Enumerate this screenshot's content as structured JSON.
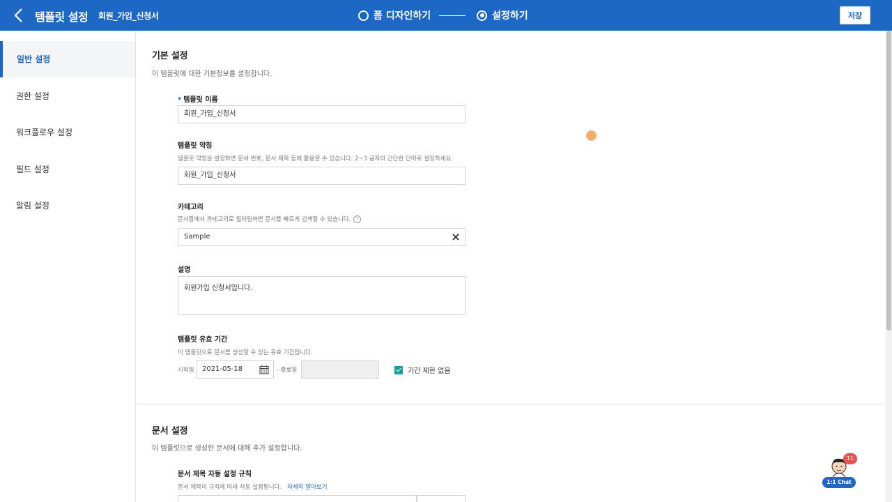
{
  "header": {
    "title": "템플릿 설정",
    "subtitle": "회원_가입_신청서",
    "steps": [
      {
        "label": "폼 디자인하기",
        "active": false
      },
      {
        "label": "설정하기",
        "active": true
      }
    ],
    "save_label": "저장",
    "bg_color": "#1c68c4"
  },
  "sidebar": {
    "items": [
      {
        "label": "일반 설정",
        "active": true
      },
      {
        "label": "권한 설정"
      },
      {
        "label": "워크플로우 설정"
      },
      {
        "label": "필드 설정"
      },
      {
        "label": "알림 설정"
      }
    ]
  },
  "basic": {
    "title": "기본 설정",
    "desc": "이 템플릿에 대한 기본정보를 설정합니다.",
    "name": {
      "label": "템플릿 이름",
      "required_mark": "*",
      "value": "회원_가입_신청서"
    },
    "abbr": {
      "label": "템플릿 약칭",
      "help": "템플릿 약칭을 설정하면 문서 번호, 문서 제목 등에 활용할 수 있습니다. 2~3 글자의 간단한 단어로 설정하세요.",
      "value": "회원_가입_신청서"
    },
    "category": {
      "label": "카테고리",
      "help": "문서함에서 카테고리로 필터링하면 문서를 빠르게 검색할 수 있습니다.",
      "help_icon": "?",
      "value": "Sample"
    },
    "description": {
      "label": "설명",
      "value": "회원가입 신청서입니다."
    },
    "validity": {
      "label": "템플릿 유효 기간",
      "help": "이 템플릿으로 문서를 생성할 수 있는 유효 기간입니다.",
      "start_label": "시작일",
      "start_value": "2021-05-18",
      "end_label": "- 종료일",
      "end_value": "",
      "no_limit_label": "기간 제한 없음",
      "no_limit_checked": true,
      "check_color": "#1a9c9a"
    }
  },
  "document": {
    "title": "문서 설정",
    "desc": "이 템플릿으로 생성한 문서에 대해 추가 설정합니다.",
    "auto_title": {
      "label": "문서 제목 자동 설정 규칙",
      "help": "문서 제목이 규칙에 따라 자동 설정됩니다.",
      "link": "자세히 알아보기"
    }
  },
  "chat": {
    "label": "1:1 Chat",
    "badge": "11"
  }
}
